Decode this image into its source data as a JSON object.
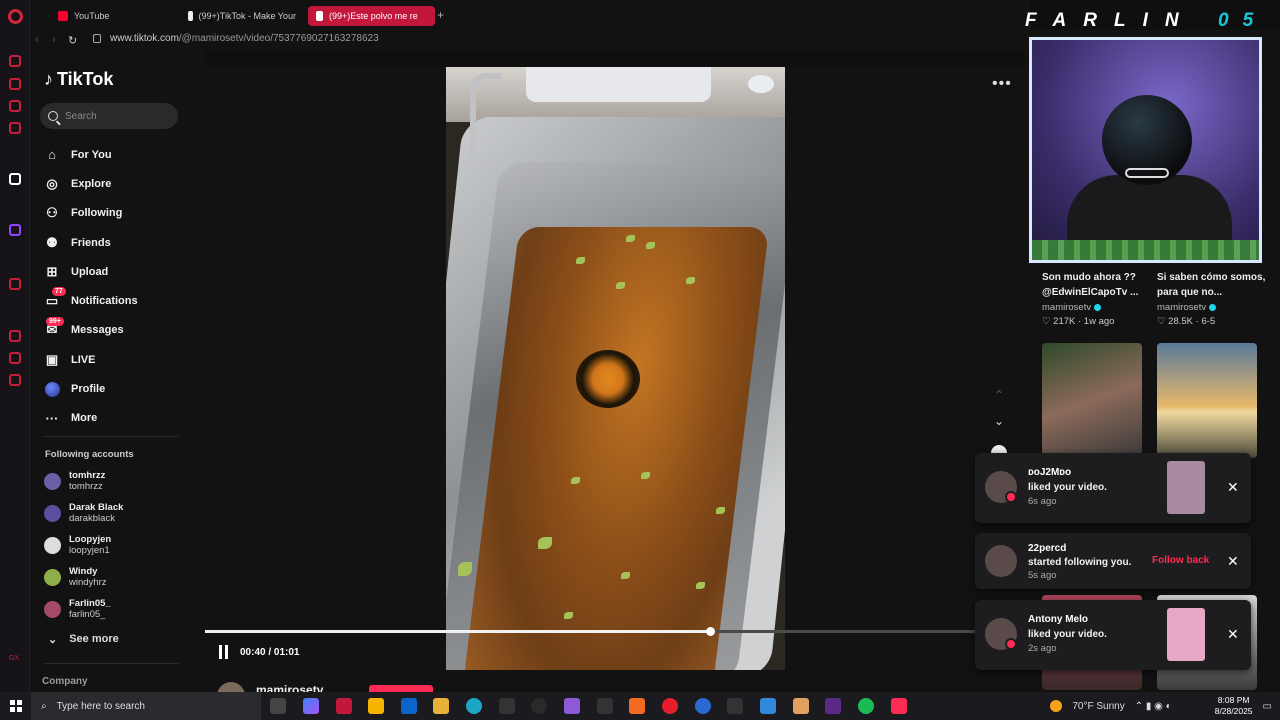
{
  "browser": {
    "tabs": [
      {
        "label": "YouTube",
        "favicon_color": "#ff0033",
        "active": false
      },
      {
        "label": "(99+)TikTok - Make Your",
        "favicon_color": "#ffffff",
        "active": false
      },
      {
        "label": "(99+)Este polvo me re",
        "favicon_color": "#ffffff",
        "active": true
      }
    ],
    "url_host": "www.tiktok.com",
    "url_path": "/@mamirosetv/video/7537769027163278623"
  },
  "tiktok": {
    "logo": "TikTok",
    "search_placeholder": "Search",
    "nav": [
      {
        "label": "For You",
        "icon": "home-icon"
      },
      {
        "label": "Explore",
        "icon": "compass-icon"
      },
      {
        "label": "Following",
        "icon": "following-icon"
      },
      {
        "label": "Friends",
        "icon": "friends-icon"
      },
      {
        "label": "Upload",
        "icon": "upload-icon"
      },
      {
        "label": "Notifications",
        "icon": "inbox-icon",
        "badge": "77"
      },
      {
        "label": "Messages",
        "icon": "messages-icon",
        "badge": "99+"
      },
      {
        "label": "LIVE",
        "icon": "live-icon"
      },
      {
        "label": "Profile",
        "icon": "profile-avatar"
      },
      {
        "label": "More",
        "icon": "more-icon"
      }
    ],
    "following_header": "Following accounts",
    "following": [
      {
        "name": "tomhrzz",
        "handle": "tomhrzz",
        "color": "#6c5ea8"
      },
      {
        "name": "Darak Black",
        "handle": "darakblack",
        "color": "#5b4fa0"
      },
      {
        "name": "Loopyjen",
        "handle": "loopyjen1",
        "color": "#ddd"
      },
      {
        "name": "Windy",
        "handle": "windyhrz",
        "color": "#8fae4a"
      },
      {
        "name": "Farlin05_",
        "handle": "farlin05_",
        "color": "#a24a68"
      }
    ],
    "see_more": "See more",
    "company": "Company"
  },
  "player": {
    "time": "00:40 / 01:01",
    "progress_fraction": 0.656,
    "author": "mamirosetv"
  },
  "overlay": {
    "farlin": "FARLIN",
    "suffix": "05"
  },
  "recommended": [
    {
      "title": "Son mudo ahora ?? @EdwinElCapoTv ...",
      "author": "mamirosetv",
      "likes": "217K",
      "age": "1w ago"
    },
    {
      "title": "Si saben cómo somos, para que no...",
      "author": "mamirosetv",
      "likes": "28.5K",
      "age": "6-5"
    }
  ],
  "notifications": [
    {
      "name": "ᴅᴏJ2Mᴅᴏ",
      "action": "liked your video.",
      "time": "6s ago",
      "thumb": "#a98aa3",
      "follow_back": ""
    },
    {
      "name": "22percd",
      "action": "started following you.",
      "time": "5s ago",
      "thumb": "",
      "follow_back": "Follow back"
    },
    {
      "name": "Antony Melo",
      "action": "liked your video.",
      "time": "2s ago",
      "thumb": "#e6a8c4",
      "follow_back": ""
    }
  ],
  "taskbar": {
    "search_placeholder": "Type here to search",
    "weather": "70°F  Sunny",
    "time": "8:08 PM",
    "date": "8/28/2025"
  },
  "colors": {
    "accent": "#fe2c55",
    "opera_red": "#c2163a"
  }
}
